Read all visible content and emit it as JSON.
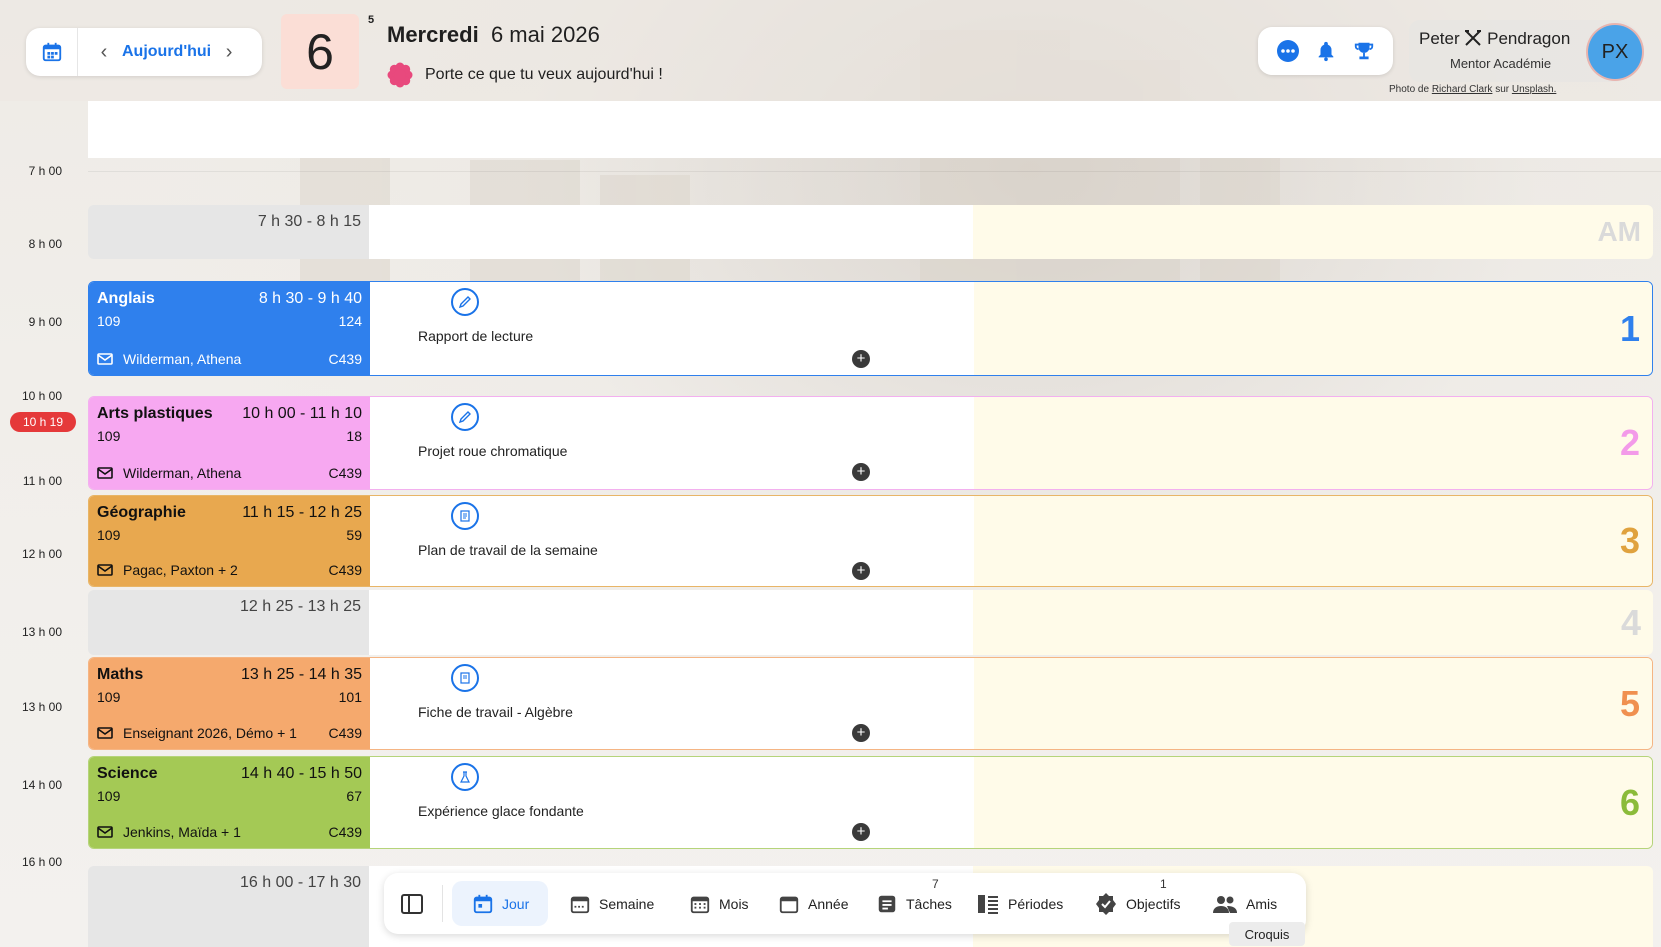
{
  "header": {
    "today_label": "Aujourd'hui",
    "day_number": "6",
    "day_super": "5",
    "weekday": "Mercredi",
    "date": "6 mai 2026",
    "motto": "Porte ce que tu veux aujourd'hui !",
    "icons": [
      "calendar-icon",
      "chevron-left-icon",
      "chevron-right-icon",
      "more-icon",
      "bell-icon",
      "trophy-icon"
    ]
  },
  "user": {
    "first": "Peter",
    "last": "Pendragon",
    "role": "Mentor Académie",
    "avatar": "PX"
  },
  "credit": {
    "prefix": "Photo de",
    "author": "Richard Clark",
    "middle": "sur",
    "site": "Unsplash."
  },
  "times": [
    "7 h 00",
    "8 h 00",
    "9 h 00",
    "10 h 00",
    "11 h 00",
    "12 h 00",
    "13 h 00",
    "13 h 00",
    "14 h 00",
    "16 h 00"
  ],
  "now": "10 h 19",
  "free_slots": [
    {
      "time": "7 h 30 - 8 h 15",
      "label": "AM"
    },
    {
      "time": "12 h 25 - 13 h 25",
      "label": "4"
    },
    {
      "time": "16 h 00 - 17 h 30"
    }
  ],
  "periods": [
    {
      "subject": "Anglais",
      "time": "8 h 30 - 9 h 40",
      "room": "109",
      "count": "124",
      "teacher": "Wilderman, Athena",
      "code": "C439",
      "task": "Rapport de lecture",
      "number": "1",
      "color": "#2f80ed",
      "num_color": "#2f80ed"
    },
    {
      "subject": "Arts plastiques",
      "time": "10 h 00 - 11 h 10",
      "room": "109",
      "count": "18",
      "teacher": "Wilderman, Athena",
      "code": "C439",
      "task": "Projet roue chromatique",
      "number": "2",
      "color": "#f7a8f1",
      "num_color": "#f39ae9"
    },
    {
      "subject": "Géographie",
      "time": "11 h 15 - 12 h 25",
      "room": "109",
      "count": "59",
      "teacher": "Pagac, Paxton + 2",
      "code": "C439",
      "task": "Plan de travail de la semaine",
      "number": "3",
      "color": "#e8a84f",
      "num_color": "#e0a23e"
    },
    {
      "subject": "Maths",
      "time": "13 h 25 - 14 h 35",
      "room": "109",
      "count": "101",
      "teacher": "Enseignant 2026, Démo + 1",
      "code": "C439",
      "task": "Fiche de travail - Algèbre",
      "number": "5",
      "color": "#f5a96d",
      "num_color": "#f09050"
    },
    {
      "subject": "Science",
      "time": "14 h 40 - 15 h 50",
      "room": "109",
      "count": "67",
      "teacher": "Jenkins, Maïda + 1",
      "code": "C439",
      "task": "Expérience glace fondante",
      "number": "6",
      "color": "#a4c955",
      "num_color": "#8bbb3a"
    }
  ],
  "toolbar": {
    "items": [
      {
        "label": "Jour"
      },
      {
        "label": "Semaine"
      },
      {
        "label": "Mois"
      },
      {
        "label": "Année"
      },
      {
        "label": "Tâches",
        "badge": "7"
      },
      {
        "label": "Périodes"
      },
      {
        "label": "Objectifs",
        "badge": "1"
      },
      {
        "label": "Amis"
      }
    ],
    "tooltip": "Croquis"
  }
}
